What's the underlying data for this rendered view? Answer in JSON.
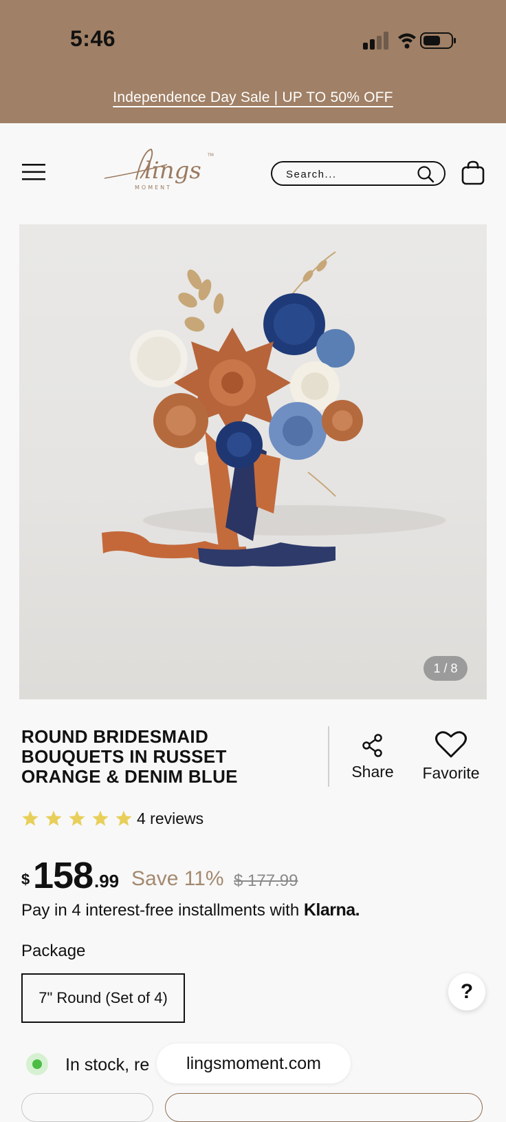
{
  "status_bar": {
    "time": "5:46"
  },
  "promo": {
    "text": "Independence Day Sale | UP TO 50% OFF",
    "background": "#a08066"
  },
  "header": {
    "logo_text": "lings",
    "logo_sub": "MOMENT",
    "logo_tm": "TM",
    "search_placeholder": "Search...",
    "brand_color": "#9c7a60"
  },
  "gallery": {
    "counter": "1 / 8"
  },
  "product": {
    "title": "ROUND BRIDESMAID BOUQUETS IN RUSSET ORANGE & DENIM BLUE",
    "share_label": "Share",
    "favorite_label": "Favorite",
    "rating_stars": 5,
    "reviews": "4 reviews",
    "price": {
      "currency": "$",
      "dollars": "158",
      "cents": ".99"
    },
    "save_text": "Save 11%",
    "was_price": "$ 177.99",
    "klarna_text": "Pay in 4 interest-free installments with",
    "klarna_brand": "Klarna."
  },
  "package": {
    "label": "Package",
    "selected": "7\" Round (Set of 4)"
  },
  "help_icon": "?",
  "stock": {
    "text": "In stock, re",
    "status_color": "#4cbc45"
  },
  "browser": {
    "url": "lingsmoment.com"
  },
  "colors": {
    "accent": "#a4896e",
    "star": "#e8cf5a"
  }
}
